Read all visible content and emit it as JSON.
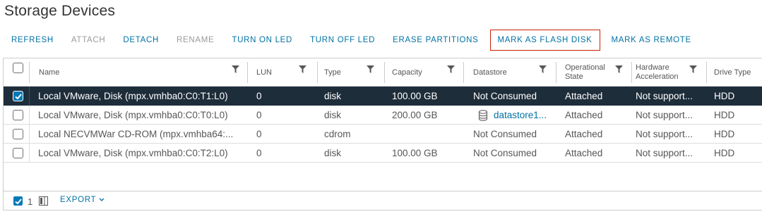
{
  "page": {
    "title": "Storage Devices"
  },
  "toolbar": {
    "refresh": "REFRESH",
    "attach": "ATTACH",
    "detach": "DETACH",
    "rename": "RENAME",
    "turn_on_led": "TURN ON LED",
    "turn_off_led": "TURN OFF LED",
    "erase_partitions": "ERASE PARTITIONS",
    "mark_as_flash_disk": "MARK AS FLASH DISK",
    "mark_as_remote": "MARK AS REMOTE"
  },
  "table": {
    "columns": {
      "name": "Name",
      "lun": "LUN",
      "type": "Type",
      "capacity": "Capacity",
      "datastore": "Datastore",
      "operational_state": "Operational State",
      "hardware_acceleration": "Hardware Acceleration",
      "drive_type": "Drive Type"
    },
    "rows": [
      {
        "selected": true,
        "name": "Local VMware, Disk (mpx.vmhba0:C0:T1:L0)",
        "lun": "0",
        "type": "disk",
        "capacity": "100.00 GB",
        "datastore": "Not Consumed",
        "datastore_link": false,
        "operational_state": "Attached",
        "hardware_acceleration": "Not support...",
        "drive_type": "HDD"
      },
      {
        "selected": false,
        "name": "Local VMware, Disk (mpx.vmhba0:C0:T0:L0)",
        "lun": "0",
        "type": "disk",
        "capacity": "200.00 GB",
        "datastore": "datastore1...",
        "datastore_link": true,
        "operational_state": "Attached",
        "hardware_acceleration": "Not support...",
        "drive_type": "HDD"
      },
      {
        "selected": false,
        "name": "Local NECVMWar CD-ROM (mpx.vmhba64:...",
        "lun": "0",
        "type": "cdrom",
        "capacity": "",
        "datastore": "Not Consumed",
        "datastore_link": false,
        "operational_state": "Attached",
        "hardware_acceleration": "Not support...",
        "drive_type": "HDD"
      },
      {
        "selected": false,
        "name": "Local VMware, Disk (mpx.vmhba0:C0:T2:L0)",
        "lun": "0",
        "type": "disk",
        "capacity": "100.00 GB",
        "datastore": "Not Consumed",
        "datastore_link": false,
        "operational_state": "Attached",
        "hardware_acceleration": "Not support...",
        "drive_type": "HDD"
      }
    ]
  },
  "footer": {
    "selected_count": "1",
    "export_label": "EXPORT"
  },
  "colors": {
    "accent": "#0072a3",
    "selected_row": "#1e2d3a",
    "checkbox_checked": "#0079b8",
    "highlight_outline": "#c92100"
  },
  "icons": {
    "filter": "filter-funnel-icon",
    "datastore": "database-icon",
    "column_toggle": "column-selector-icon",
    "export_caret": "chevron-down-icon"
  }
}
